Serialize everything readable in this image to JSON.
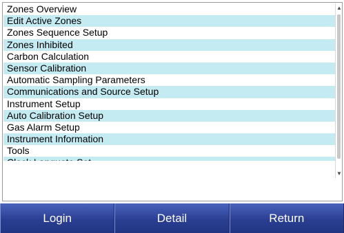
{
  "menu": {
    "items": [
      {
        "label": "Zones Overview"
      },
      {
        "label": "Edit Active Zones"
      },
      {
        "label": "Zones Sequence Setup"
      },
      {
        "label": "Zones Inhibited"
      },
      {
        "label": "Carbon Calculation"
      },
      {
        "label": "Sensor Calibration"
      },
      {
        "label": "Automatic Sampling Parameters"
      },
      {
        "label": "Communications and Source Setup"
      },
      {
        "label": "Instrument Setup"
      },
      {
        "label": "Auto Calibration Setup"
      },
      {
        "label": "Gas Alarm Setup"
      },
      {
        "label": "Instrument Information"
      },
      {
        "label": "Tools"
      },
      {
        "label": "Clock Languate Set"
      }
    ],
    "alt_row_color": "#c4eaf2"
  },
  "scrollbar": {
    "up_icon": "scroll-up-arrow",
    "down_icon": "scroll-down-arrow"
  },
  "footer": {
    "login_label": "Login",
    "detail_label": "Detail",
    "return_label": "Return",
    "button_color": "#2b3f92"
  }
}
